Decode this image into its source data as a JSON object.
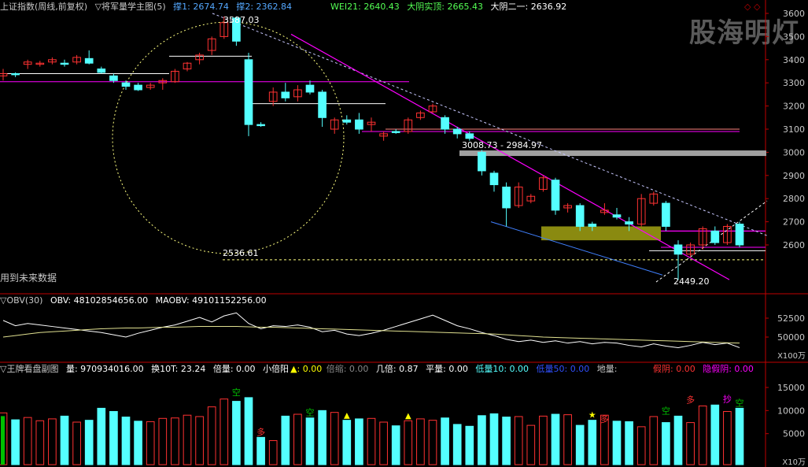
{
  "colors": {
    "up": "#ff3232",
    "down": "#54ffff",
    "text": "#c8c8c8",
    "axis": "#c00000",
    "ma_pink": "#ff00ff",
    "yellow": "#ffff00",
    "white": "#ffffff",
    "green": "#00c000"
  },
  "header": {
    "index_name": "上证指数(周线,前复权)",
    "formula": "▽将军量学主图(5)",
    "support1": "撑1: 2674.74",
    "support2": "撑2: 2362.84",
    "wei21": "WEI21: 2640.43",
    "big_yin_real": "大阴实顶: 2665.43",
    "big_yin_2": "大阴二一: 2636.92",
    "top_icons": "◇ ◇"
  },
  "watermark": "股海明灯",
  "main_notes": {
    "future_data": "用到未来数据",
    "peak": "3587.03",
    "circle_low": "2536.61",
    "range": "3008.73 - 2984.97",
    "low": "2449.20"
  },
  "obv_header": {
    "name": "▽OBV(30)",
    "obv": "OBV: 48102854656.00",
    "maobv": "MAOBV: 49101152256.00"
  },
  "vol_header": {
    "name": "▽王牌看盘副图",
    "vol": "量: 970934016.00",
    "turnover": "换10T: 23.24",
    "bei": "倍量: 0.00",
    "small_bei": "小倍阳",
    "small_bei_val": "▲: 0.00",
    "suo": "倍缩: 0.00",
    "ji": "几倍: 0.87",
    "ping": "平量: 0.00",
    "low10": "低量10: 0.00",
    "low50": "低量50: 0.00",
    "di": "地量:",
    "fake_yin": "假阴: 0.00",
    "hidden_fake": "隐假阴: 0.00"
  },
  "markers": {
    "kong": "空",
    "duo": "多",
    "chao": "抄"
  },
  "axis": {
    "main_ticks": [
      "3600",
      "3500",
      "3400",
      "3300",
      "3200",
      "3100",
      "3000",
      "2900",
      "2800",
      "2700",
      "2600"
    ],
    "obv_ticks": [
      "52500",
      "50000"
    ],
    "obv_unit": "X100万",
    "vol_ticks": [
      "15000",
      "10000",
      "5000"
    ],
    "vol_unit": "X10万"
  },
  "chart_data": {
    "type": "candlestick",
    "title": "上证指数(周线,前复权)",
    "price_range": [
      2400,
      3650
    ],
    "candles": [
      {
        "o": 3330,
        "h": 3360,
        "l": 3310,
        "c": 3340
      },
      {
        "o": 3340,
        "h": 3345,
        "l": 3325,
        "c": 3335
      },
      {
        "o": 3380,
        "h": 3400,
        "l": 3360,
        "c": 3390
      },
      {
        "o": 3380,
        "h": 3395,
        "l": 3370,
        "c": 3385
      },
      {
        "o": 3390,
        "h": 3410,
        "l": 3380,
        "c": 3400
      },
      {
        "o": 3385,
        "h": 3400,
        "l": 3370,
        "c": 3380
      },
      {
        "o": 3390,
        "h": 3420,
        "l": 3380,
        "c": 3410
      },
      {
        "o": 3405,
        "h": 3440,
        "l": 3380,
        "c": 3385
      },
      {
        "o": 3360,
        "h": 3370,
        "l": 3340,
        "c": 3345
      },
      {
        "o": 3330,
        "h": 3340,
        "l": 3300,
        "c": 3310
      },
      {
        "o": 3300,
        "h": 3310,
        "l": 3270,
        "c": 3285
      },
      {
        "o": 3290,
        "h": 3300,
        "l": 3265,
        "c": 3270
      },
      {
        "o": 3280,
        "h": 3300,
        "l": 3270,
        "c": 3290
      },
      {
        "o": 3300,
        "h": 3320,
        "l": 3270,
        "c": 3310
      },
      {
        "o": 3305,
        "h": 3360,
        "l": 3300,
        "c": 3350
      },
      {
        "o": 3360,
        "h": 3390,
        "l": 3350,
        "c": 3385
      },
      {
        "o": 3400,
        "h": 3430,
        "l": 3380,
        "c": 3420
      },
      {
        "o": 3440,
        "h": 3500,
        "l": 3420,
        "c": 3490
      },
      {
        "o": 3500,
        "h": 3587,
        "l": 3490,
        "c": 3560
      },
      {
        "o": 3580,
        "h": 3587,
        "l": 3460,
        "c": 3480
      },
      {
        "o": 3400,
        "h": 3430,
        "l": 3070,
        "c": 3120
      },
      {
        "o": 3120,
        "h": 3130,
        "l": 3110,
        "c": 3115
      },
      {
        "o": 3220,
        "h": 3280,
        "l": 3200,
        "c": 3260
      },
      {
        "o": 3260,
        "h": 3300,
        "l": 3220,
        "c": 3235
      },
      {
        "o": 3240,
        "h": 3290,
        "l": 3220,
        "c": 3270
      },
      {
        "o": 3290,
        "h": 3310,
        "l": 3250,
        "c": 3260
      },
      {
        "o": 3260,
        "h": 3270,
        "l": 3110,
        "c": 3150
      },
      {
        "o": 3100,
        "h": 3150,
        "l": 3080,
        "c": 3140
      },
      {
        "o": 3140,
        "h": 3160,
        "l": 3120,
        "c": 3130
      },
      {
        "o": 3140,
        "h": 3170,
        "l": 3080,
        "c": 3100
      },
      {
        "o": 3120,
        "h": 3150,
        "l": 3090,
        "c": 3130
      },
      {
        "o": 3070,
        "h": 3090,
        "l": 3050,
        "c": 3080
      },
      {
        "o": 3090,
        "h": 3100,
        "l": 3080,
        "c": 3085
      },
      {
        "o": 3090,
        "h": 3150,
        "l": 3080,
        "c": 3140
      },
      {
        "o": 3150,
        "h": 3180,
        "l": 3140,
        "c": 3170
      },
      {
        "o": 3175,
        "h": 3210,
        "l": 3170,
        "c": 3200
      },
      {
        "o": 3150,
        "h": 3160,
        "l": 3080,
        "c": 3100
      },
      {
        "o": 3100,
        "h": 3110,
        "l": 3060,
        "c": 3080
      },
      {
        "o": 3080,
        "h": 3090,
        "l": 3050,
        "c": 3060
      },
      {
        "o": 3000,
        "h": 3010,
        "l": 2900,
        "c": 2920
      },
      {
        "o": 2910,
        "h": 2920,
        "l": 2830,
        "c": 2860
      },
      {
        "o": 2850,
        "h": 2870,
        "l": 2680,
        "c": 2760
      },
      {
        "o": 2770,
        "h": 2870,
        "l": 2760,
        "c": 2850
      },
      {
        "o": 2790,
        "h": 2820,
        "l": 2780,
        "c": 2810
      },
      {
        "o": 2840,
        "h": 2900,
        "l": 2830,
        "c": 2890
      },
      {
        "o": 2880,
        "h": 2890,
        "l": 2730,
        "c": 2750
      },
      {
        "o": 2760,
        "h": 2780,
        "l": 2740,
        "c": 2770
      },
      {
        "o": 2770,
        "h": 2780,
        "l": 2660,
        "c": 2680
      },
      {
        "o": 2690,
        "h": 2700,
        "l": 2660,
        "c": 2680
      },
      {
        "o": 2740,
        "h": 2780,
        "l": 2730,
        "c": 2750
      },
      {
        "o": 2730,
        "h": 2760,
        "l": 2710,
        "c": 2720
      },
      {
        "o": 2700,
        "h": 2720,
        "l": 2660,
        "c": 2690
      },
      {
        "o": 2690,
        "h": 2820,
        "l": 2680,
        "c": 2800
      },
      {
        "o": 2780,
        "h": 2830,
        "l": 2770,
        "c": 2820
      },
      {
        "o": 2780,
        "h": 2790,
        "l": 2660,
        "c": 2680
      },
      {
        "o": 2600,
        "h": 2620,
        "l": 2449,
        "c": 2560
      },
      {
        "o": 2560,
        "h": 2610,
        "l": 2550,
        "c": 2600
      },
      {
        "o": 2600,
        "h": 2680,
        "l": 2580,
        "c": 2670
      },
      {
        "o": 2660,
        "h": 2680,
        "l": 2600,
        "c": 2610
      },
      {
        "o": 2610,
        "h": 2690,
        "l": 2600,
        "c": 2680
      },
      {
        "o": 2690,
        "h": 2700,
        "l": 2590,
        "c": 2600
      }
    ],
    "obv": [
      52200,
      51500,
      51800,
      51600,
      51400,
      51200,
      51000,
      50800,
      50600,
      50300,
      50000,
      50500,
      50900,
      51300,
      51600,
      52100,
      52600,
      52000,
      52800,
      53200,
      51800,
      51100,
      51500,
      51400,
      51600,
      51300,
      50700,
      50900,
      50400,
      50200,
      50500,
      50900,
      51400,
      51900,
      52400,
      52900,
      52200,
      51500,
      51100,
      50600,
      50200,
      49700,
      49400,
      49600,
      49300,
      49500,
      49200,
      49400,
      49100,
      49300,
      49200,
      48900,
      48700,
      49100,
      48800,
      48600,
      48900,
      49300,
      49000,
      49200,
      48600
    ],
    "maobv": [
      50000,
      50200,
      50400,
      50600,
      50700,
      50800,
      50900,
      51000,
      51100,
      51150,
      51200,
      51200,
      51250,
      51300,
      51300,
      51350,
      51400,
      51400,
      51400,
      51400,
      51350,
      51300,
      51300,
      51250,
      51200,
      51150,
      51100,
      51050,
      51000,
      50950,
      50900,
      50850,
      50800,
      50750,
      50700,
      50650,
      50600,
      50550,
      50500,
      50450,
      50400,
      50300,
      50200,
      50100,
      50000,
      49950,
      49900,
      49850,
      49800,
      49750,
      49700,
      49650,
      49600,
      49550,
      49500,
      49450,
      49400,
      49350,
      49300,
      49250,
      49200
    ],
    "volume": [
      9500,
      8000,
      8500,
      7800,
      8200,
      8800,
      7500,
      7900,
      10500,
      9800,
      8600,
      7700,
      7600,
      8300,
      8400,
      9000,
      8700,
      10800,
      12500,
      12000,
      12800,
      4200,
      3500,
      8800,
      9200,
      8400,
      10000,
      9600,
      7900,
      8200,
      8300,
      7500,
      6700,
      7800,
      8200,
      7900,
      8400,
      7000,
      6600,
      8900,
      9300,
      8600,
      8700,
      6800,
      8800,
      9200,
      9100,
      6800,
      7900,
      9000,
      7700,
      7600,
      6500,
      8700,
      7400,
      8800,
      7400,
      11000,
      11200,
      9800,
      10500
    ]
  }
}
